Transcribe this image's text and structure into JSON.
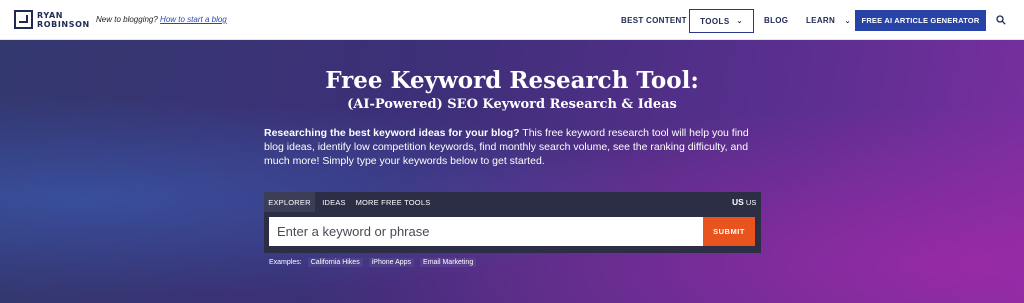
{
  "header": {
    "logo_line1": "RYAN",
    "logo_line2": "ROBINSON",
    "tagline_text": "New to blogging? ",
    "tagline_link": "How to start a blog",
    "nav": {
      "best_content": "BEST CONTENT",
      "tools": "TOOLS",
      "blog": "BLOG",
      "learn": "LEARN",
      "cta": "FREE AI ARTICLE GENERATOR"
    }
  },
  "hero": {
    "title": "Free Keyword Research Tool:",
    "subtitle": "(AI-Powered) SEO Keyword Research & Ideas",
    "desc_bold": "Researching the best keyword ideas for your blog?",
    "desc_rest": " This free keyword research tool will help you find blog ideas, identify low competition keywords, find monthly search volume, see the ranking difficulty, and much more! Simply type your keywords below to get started."
  },
  "search": {
    "tabs": [
      "EXPLORER",
      "IDEAS",
      "MORE FREE TOOLS"
    ],
    "country_bold": "US",
    "country": "US",
    "placeholder": "Enter a keyword or phrase",
    "submit": "SUBMIT",
    "examples_label": "Examples:",
    "examples": [
      "California Hikes",
      "iPhone Apps",
      "Email Marketing"
    ]
  },
  "colors": {
    "brand_navy": "#1e2a55",
    "cta_blue": "#2743a8",
    "submit_orange": "#e8531e"
  },
  "icons": {
    "logo": "logo-mark-icon",
    "search": "search-icon",
    "chevron": "chevron-down-icon"
  }
}
